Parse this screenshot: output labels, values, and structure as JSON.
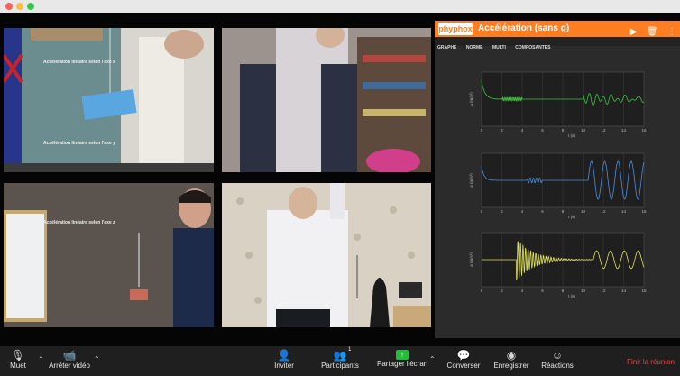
{
  "phyphox": {
    "logo": "phyphox",
    "title": "Accélération (sans g)",
    "tabs": [
      "GRAPHE",
      "NORME",
      "MULTI",
      "COMPOSANTES"
    ],
    "graphs": [
      {
        "title": "Accélération linéaire selon l'axe x",
        "ylabel": "a (m/s²)",
        "xlabel": "t (s)"
      },
      {
        "title": "Accélération linéaire selon l'axe y",
        "ylabel": "a (m/s²)",
        "xlabel": "t (s)"
      },
      {
        "title": "Accélération linéaire selon l'axe z",
        "ylabel": "a (m/s²)",
        "xlabel": "t (s)"
      }
    ],
    "xticks": [
      "0",
      "2",
      "4",
      "6",
      "8",
      "10",
      "12",
      "14",
      "16"
    ],
    "colors": {
      "header": "#ff7e22",
      "x": "#3ec23e",
      "y": "#4f8fe0",
      "z": "#e4e45a"
    }
  },
  "toolbar": {
    "mute": "Muet",
    "stop_video": "Arrêter vidéo",
    "invite": "Inviter",
    "participants": "Participants",
    "participants_count": "1",
    "share": "Partager l'écran",
    "chat": "Converser",
    "record": "Enregistrer",
    "reactions": "Réactions",
    "end": "Finir la réunion"
  }
}
